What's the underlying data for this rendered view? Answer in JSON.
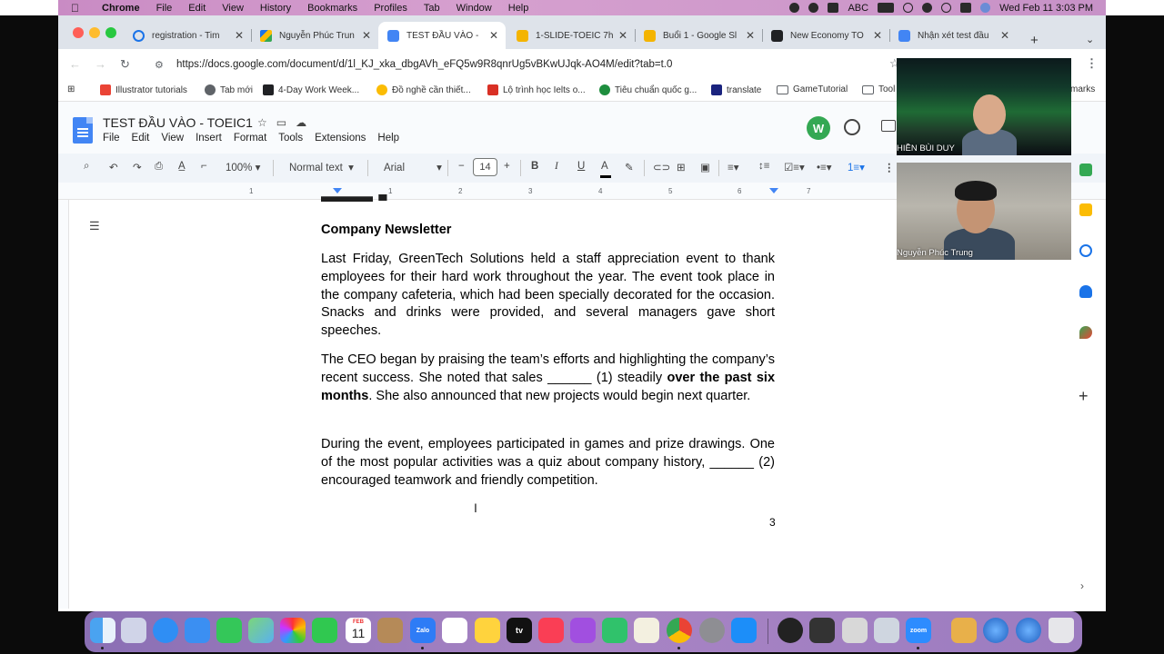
{
  "menubar": {
    "app": "Chrome",
    "items": [
      "File",
      "Edit",
      "View",
      "History",
      "Bookmarks",
      "Profiles",
      "Tab",
      "Window",
      "Help"
    ],
    "input_source": "ABC",
    "datetime": "Wed Feb 11  3:03 PM"
  },
  "tabs": [
    {
      "title": "registration - Tim",
      "icon_color": "#1a73e8",
      "active": false
    },
    {
      "title": "Nguyễn Phúc Trun",
      "icon_color": "#fbbc04",
      "active": false
    },
    {
      "title": "TEST ĐẦU VÀO -",
      "icon_color": "#4285f4",
      "active": true
    },
    {
      "title": "1-SLIDE-TOEIC 7h",
      "icon_color": "#f4b400",
      "active": false
    },
    {
      "title": "Buổi 1 - Google Sl",
      "icon_color": "#f4b400",
      "active": false
    },
    {
      "title": "New Economy TO",
      "icon_color": "#202124",
      "active": false
    },
    {
      "title": "Nhận xét test đầu",
      "icon_color": "#4285f4",
      "active": false
    }
  ],
  "address": {
    "url": "https://docs.google.com/document/d/1l_KJ_xka_dbgAVh_eFQ5w9R8qnrUg5vBKwUJqk-AO4M/edit?tab=t.0"
  },
  "bookmarks": [
    {
      "label": "Illustrator tutorials",
      "icon_color": "#ea4335"
    },
    {
      "label": "Tab mới",
      "icon_color": "#5f6368"
    },
    {
      "label": "4-Day Work Week...",
      "icon_color": "#202124"
    },
    {
      "label": "Đồ nghề cần thiết...",
      "icon_color": "#fbbc04"
    },
    {
      "label": "Lộ trình học Ielts o...",
      "icon_color": "#d93025"
    },
    {
      "label": "Tiêu chuẩn quốc g...",
      "icon_color": "#1e8e3e"
    },
    {
      "label": "translate",
      "icon_color": "#1a237e"
    },
    {
      "label": "GameTutorial",
      "icon_color": "folder"
    },
    {
      "label": "Tool",
      "icon_color": "folder"
    },
    {
      "label": "marks",
      "icon_color": "none"
    }
  ],
  "doc": {
    "title": "TEST ĐẦU VÀO - TOEIC1",
    "menu": [
      "File",
      "Edit",
      "View",
      "Insert",
      "Format",
      "Tools",
      "Extensions",
      "Help"
    ]
  },
  "toolbar": {
    "zoom": "100%",
    "style": "Normal text",
    "font": "Arial",
    "font_size": "14"
  },
  "ruler": {
    "numbers": [
      "1",
      "1",
      "2",
      "3",
      "4",
      "5",
      "6",
      "7"
    ]
  },
  "content": {
    "heading": "Company Newsletter",
    "p1": "Last Friday, GreenTech Solutions held a staff appreciation event to thank employees for their hard work throughout the year. The event took place in the company cafeteria, which had been specially decorated for the occasion. Snacks and drinks were provided, and several managers gave short speeches.",
    "p2_start": "The CEO began by praising the team’s efforts and highlighting the company’s recent success. She noted that sales ______ (1) steadily ",
    "p2_bold": "over the past six months",
    "p2_end": ". She also announced that new projects would begin next quarter.",
    "p3": "During the event, employees participated in games and prize drawings. One of the most popular activities was a quiz about company history, ______ (2) encouraged teamwork and friendly competition.",
    "page_number": "3"
  },
  "video": {
    "participant1": "HIỀN BÙI DUY",
    "participant2": "Nguyễn Phúc Trung"
  },
  "dock": {
    "calendar_month": "FEB",
    "calendar_day": "11",
    "apps": [
      "finder-icon",
      "launchpad-icon",
      "safari-icon",
      "mail-icon",
      "messages-icon",
      "maps-icon",
      "photos-icon",
      "facetime-icon",
      "calendar-icon",
      "notes-brown-icon",
      "zalo-icon",
      "reminders-icon",
      "notes-icon",
      "appletv-icon",
      "music-icon",
      "podcasts-icon",
      "numbers-icon",
      "freeform-icon",
      "chrome-icon",
      "settings-icon",
      "appstore-icon",
      "obs-icon",
      "inkscape-icon",
      "printer-icon",
      "downloads-icon",
      "zoom-icon",
      "package-icon",
      "globe-icon",
      "globe2-icon",
      "trash-icon"
    ],
    "labels": {
      "zalo": "Zalo",
      "tv": "tv",
      "zoom": "zoom"
    }
  }
}
